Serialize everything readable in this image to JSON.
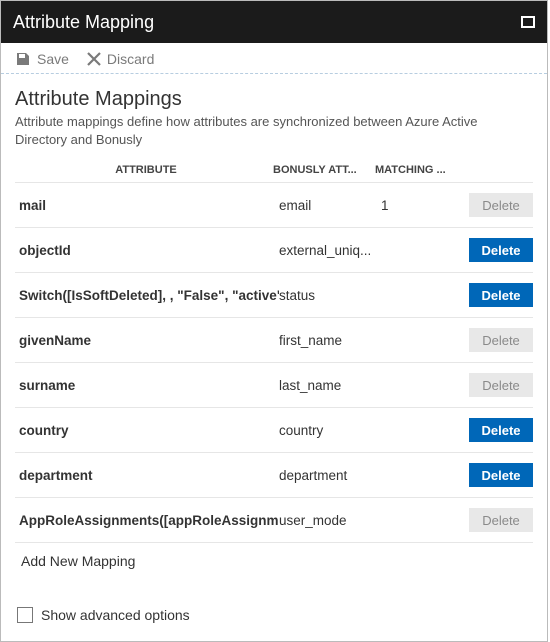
{
  "titlebar": {
    "title": "Attribute Mapping"
  },
  "toolbar": {
    "save_label": "Save",
    "discard_label": "Discard"
  },
  "section": {
    "heading": "Attribute Mappings",
    "description": "Attribute mappings define how attributes are synchronized between Azure Active Directory and Bonusly"
  },
  "columns": {
    "attribute": "ATTRIBUTE",
    "bonusly": "BONUSLY ATT...",
    "matching": "MATCHING ..."
  },
  "rows": [
    {
      "attribute": "mail",
      "bonusly": "email",
      "matching": "1",
      "delete_label": "Delete",
      "delete_primary": false
    },
    {
      "attribute": "objectId",
      "bonusly": "external_uniq...",
      "matching": "",
      "delete_label": "Delete",
      "delete_primary": true
    },
    {
      "attribute": "Switch([IsSoftDeleted], , \"False\", \"active\", \"True",
      "bonusly": "status",
      "matching": "",
      "delete_label": "Delete",
      "delete_primary": true
    },
    {
      "attribute": "givenName",
      "bonusly": "first_name",
      "matching": "",
      "delete_label": "Delete",
      "delete_primary": false
    },
    {
      "attribute": "surname",
      "bonusly": "last_name",
      "matching": "",
      "delete_label": "Delete",
      "delete_primary": false
    },
    {
      "attribute": "country",
      "bonusly": "country",
      "matching": "",
      "delete_label": "Delete",
      "delete_primary": true
    },
    {
      "attribute": "department",
      "bonusly": "department",
      "matching": "",
      "delete_label": "Delete",
      "delete_primary": true
    },
    {
      "attribute": "AppRoleAssignments([appRoleAssignments])",
      "bonusly": "user_mode",
      "matching": "",
      "delete_label": "Delete",
      "delete_primary": false
    }
  ],
  "add_mapping_label": "Add New Mapping",
  "footer": {
    "advanced_label": "Show advanced options"
  }
}
